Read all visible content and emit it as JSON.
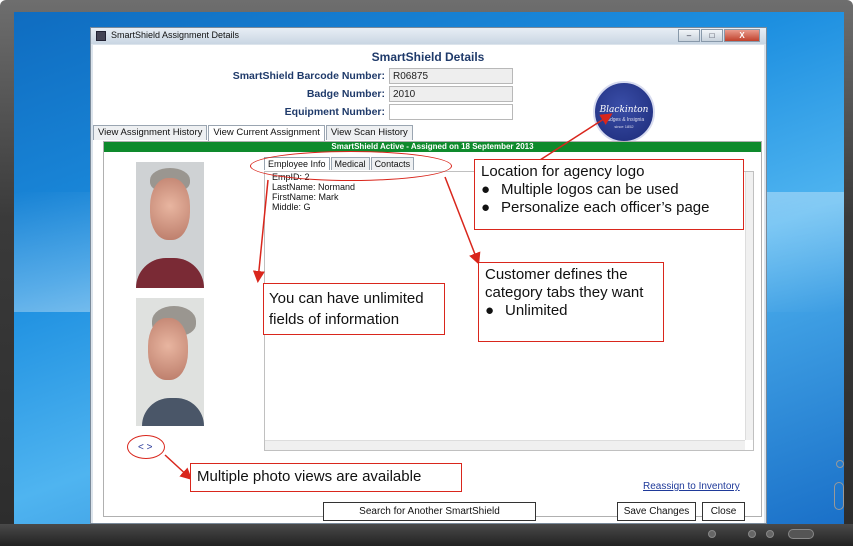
{
  "window": {
    "title": "SmartShield Assignment Details",
    "minimize_label": "–",
    "maximize_label": "□",
    "close_label": "X"
  },
  "header": {
    "title": "SmartShield Details",
    "barcode_label": "SmartShield Barcode Number:",
    "barcode_value": "R06875",
    "badge_label": "Badge Number:",
    "badge_value": "2010",
    "equipment_label": "Equipment Number:",
    "equipment_value": ""
  },
  "logo": {
    "brand": "Blackinton",
    "sub": "Badges & Insignia",
    "since": "since 1852"
  },
  "tabs": [
    {
      "label": "View Assignment History"
    },
    {
      "label": "View Current Assignment",
      "active": true
    },
    {
      "label": "View Scan History"
    }
  ],
  "status": {
    "text": "SmartShield Active - Assigned on 18 September 2013",
    "color": "#0e8a2c"
  },
  "photo_nav": "< >",
  "inner_tabs": [
    {
      "label": "Employee Info",
      "active": true
    },
    {
      "label": "Medical"
    },
    {
      "label": "Contacts"
    }
  ],
  "employee": {
    "lines": [
      "EmpID: 2",
      "LastName: Normand",
      "FirstName: Mark",
      "Middle: G"
    ]
  },
  "links": {
    "reassign": "Reassign to Inventory"
  },
  "buttons": {
    "search": "Search for Another SmartShield",
    "save": "Save Changes",
    "close": "Close"
  },
  "annotations": {
    "logo": {
      "title": "Location for agency logo",
      "bullets": [
        "Multiple logos can be used",
        "Personalize each officer’s page"
      ]
    },
    "tabs": {
      "lines": [
        "Customer defines the",
        "category tabs they want"
      ],
      "bullets": [
        "Unlimited"
      ]
    },
    "fields": {
      "lines": [
        "You can have unlimited",
        "fields of information"
      ]
    },
    "photos": {
      "text": "Multiple photo views are available"
    },
    "bullet_char": "●"
  },
  "colors": {
    "annotation_red": "#d9261c",
    "accent_blue": "#1f3a6a"
  }
}
